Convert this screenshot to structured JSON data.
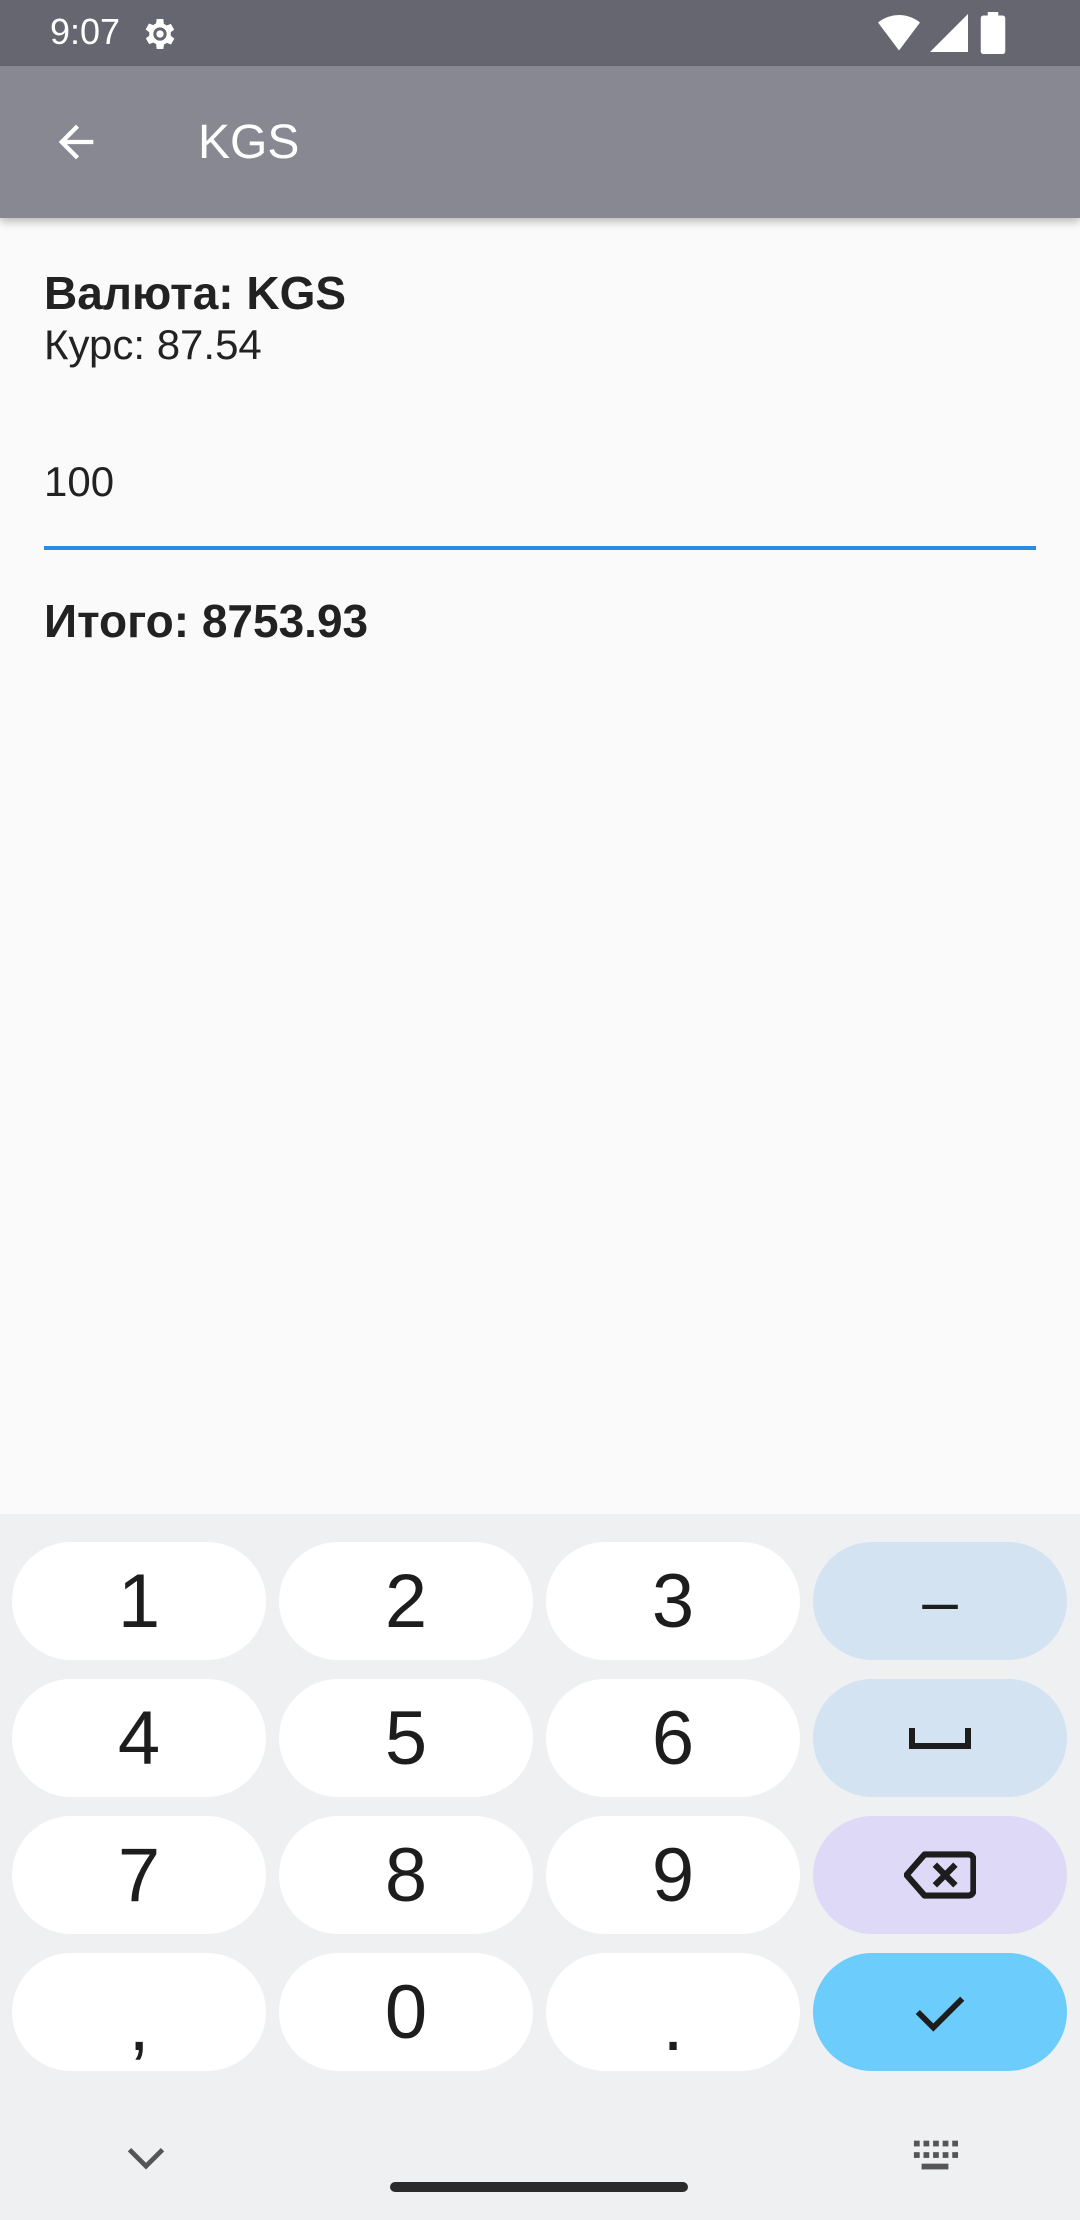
{
  "status_bar": {
    "time": "9:07",
    "icons": [
      "gear-icon",
      "wifi-icon",
      "signal-icon",
      "battery-icon"
    ]
  },
  "app_bar": {
    "back_icon": "arrow-back-icon",
    "title": "KGS"
  },
  "content": {
    "currency_line": "Валюта: KGS",
    "rate_line": "Курс: 87.54",
    "amount_value": "100",
    "total_line": "Итого: 8753.93"
  },
  "keyboard": {
    "keys": {
      "k1": "1",
      "k2": "2",
      "k3": "3",
      "minus": "–",
      "k4": "4",
      "k5": "5",
      "k6": "6",
      "space_icon": "space-icon",
      "k7": "7",
      "k8": "8",
      "k9": "9",
      "backspace_icon": "backspace-icon",
      "comma": ",",
      "k0": "0",
      "period": ".",
      "enter_icon": "checkmark-icon"
    },
    "bottom_left_icon": "chevron-down-icon",
    "bottom_right_icon": "keyboard-switch-icon"
  },
  "colors": {
    "status_bar": "#666670",
    "app_bar": "#888893",
    "accent_underline": "#2a8ce0",
    "key_function": "#d3e3f1",
    "key_delete": "#ddd9f7",
    "key_enter": "#6cccfb"
  }
}
